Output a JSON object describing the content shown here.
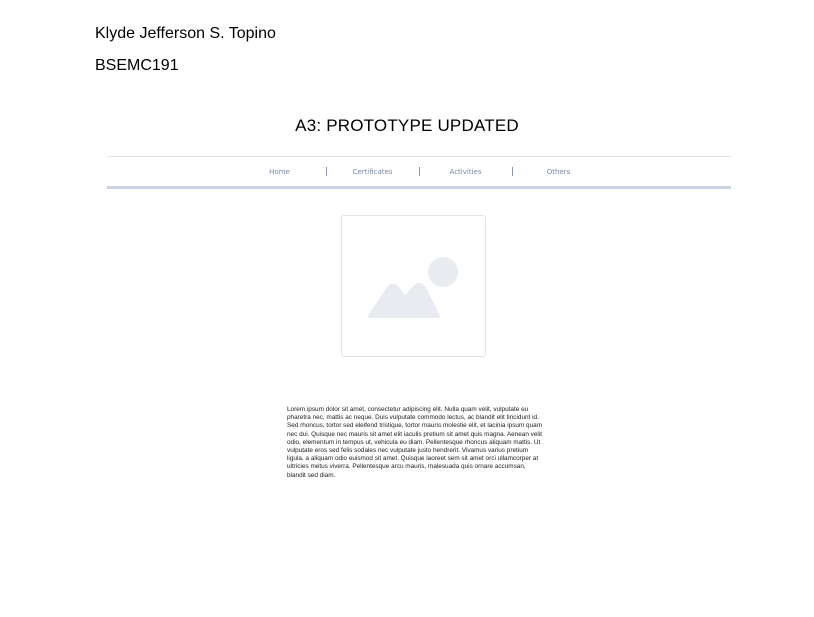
{
  "document": {
    "author": "Klyde Jefferson S. Topino",
    "section": "BSEMC191",
    "title": "A3: PROTOTYPE UPDATED"
  },
  "prototype": {
    "nav": {
      "items": [
        {
          "label": "Home"
        },
        {
          "label": "Certificates"
        },
        {
          "label": "Activities"
        },
        {
          "label": "Others"
        }
      ]
    },
    "image_placeholder": {
      "icon": "image-placeholder-icon"
    },
    "body_text": "Lorem ipsum dolor sit amet, consectetur adipiscing elit. Nulla quam velit, vulputate eu pharetra nec, mattis ac neque. Duis vulputate commodo lectus, ac blandit elit tincidunt id. Sed rhoncus, tortor sed eleifend tristique, tortor mauris molestie elit, et lacinia ipsum quam nec dui. Quisque nec mauris sit amet elit iaculis pretium sit amet quis magna. Aenean velit odio, elementum in tempus ut, vehicula eu diam. Pellentesque rhoncus aliquam mattis. Ut vulputate eros sed felis sodales nec vulputate justo hendrerit. Vivamus varius pretium ligula, a aliquam odio euismod sit amet. Quisque laoreet sem sit amet orci ullamcorper at ultricies metus viverra. Pellentesque arcu mauris, malesuada quis ornare accumsan, blandit sed diam."
  },
  "colors": {
    "nav_text": "#7a86a8",
    "nav_bar": "#c9d3e3",
    "placeholder_shape": "#e8ebf0"
  }
}
